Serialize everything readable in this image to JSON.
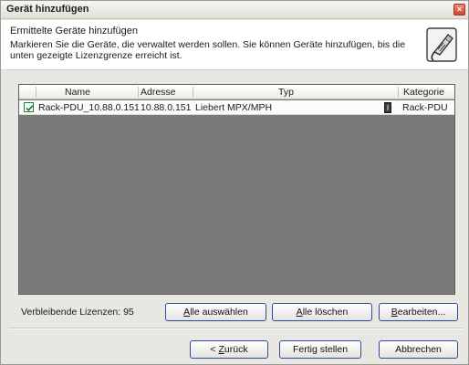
{
  "window": {
    "title": "Gerät hinzufügen",
    "close_glyph": "×"
  },
  "header": {
    "title": "Ermittelte Geräte hinzufügen",
    "description": "Markieren Sie die Geräte, die verwaltet werden sollen. Sie können Geräte hinzufügen, bis die unten gezeigte Lizenzgrenze erreicht ist.",
    "icon": "network-cable-icon"
  },
  "table": {
    "columns": [
      "Name",
      "Adresse",
      "Typ",
      "Kategorie"
    ],
    "rows": [
      {
        "checked": true,
        "name": "Rack-PDU_10.88.0.151",
        "address": "10.88.0.151",
        "type": "Liebert MPX/MPH",
        "category_icon": "pdu-device-icon",
        "category": "Rack-PDU"
      }
    ]
  },
  "footer": {
    "license_label": "Verbleibende Lizenzen: 95",
    "select_all": {
      "accel": "A",
      "rest": "lle auswählen"
    },
    "clear_all": {
      "accel": "A",
      "rest": "lle löschen"
    },
    "edit": {
      "accel": "B",
      "rest": "earbeiten..."
    }
  },
  "nav": {
    "back": {
      "prefix": "< ",
      "accel": "Z",
      "rest": "urück"
    },
    "finish": "Fertig stellen",
    "cancel": "Abbrechen"
  },
  "colors": {
    "list_background": "#7a7a7a",
    "button_border": "#2a4d9c",
    "close_button": "#d04430"
  }
}
